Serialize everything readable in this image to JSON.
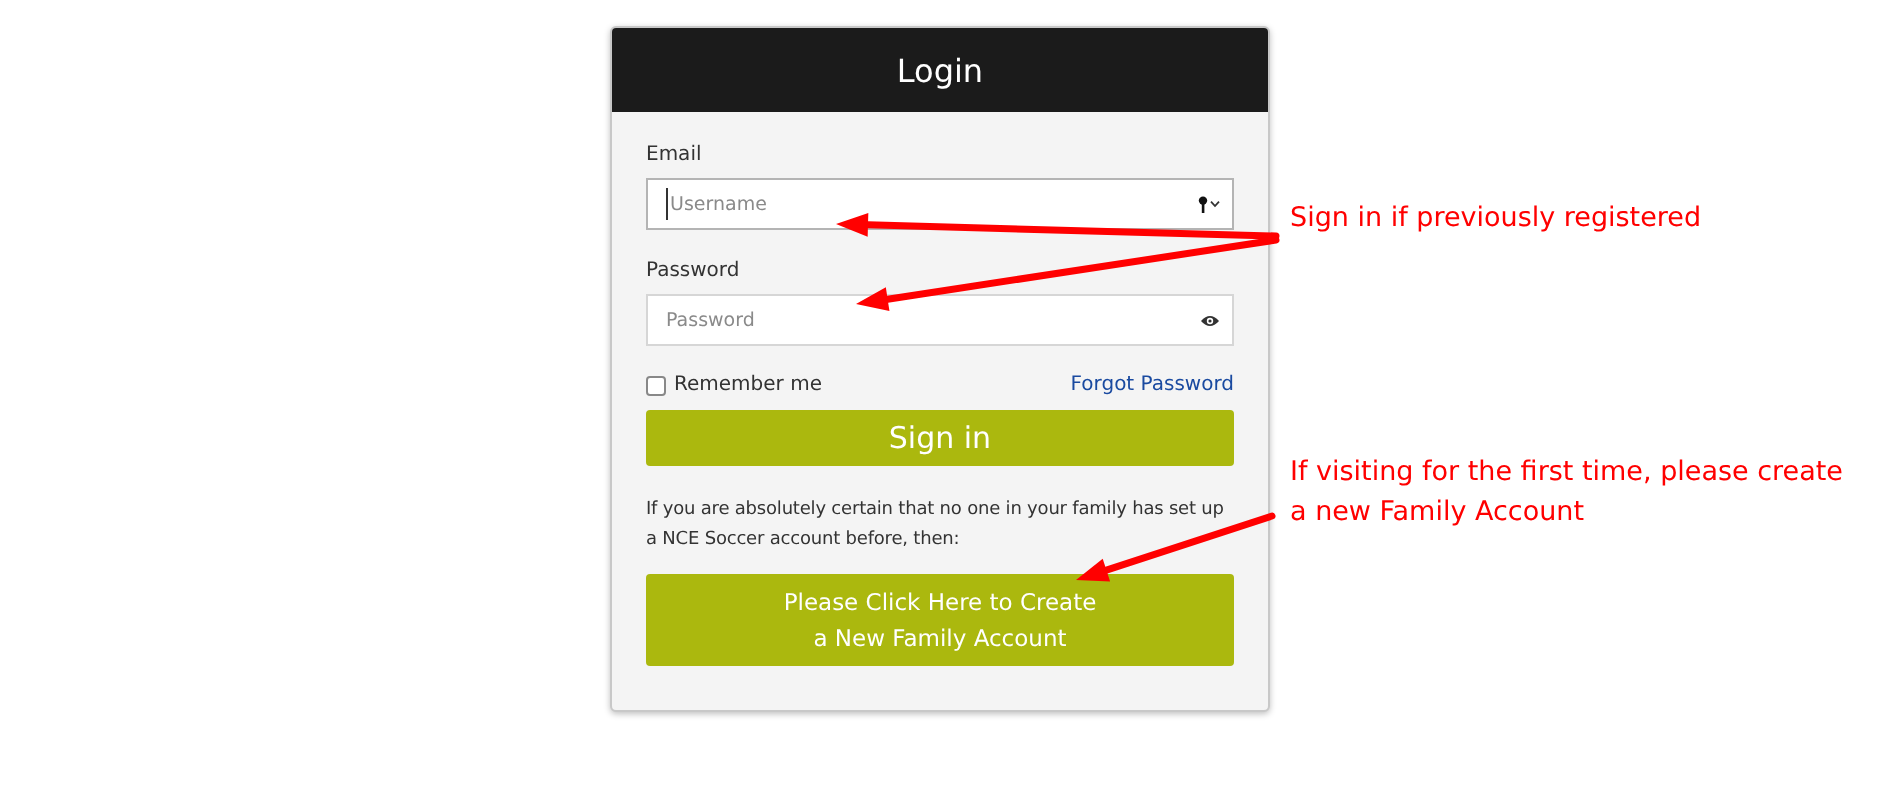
{
  "login_card": {
    "title": "Login",
    "fields": [
      {
        "label": "Email",
        "placeholder": "Username",
        "kind": "username",
        "focused": true
      },
      {
        "label": "Password",
        "placeholder": "Password",
        "kind": "password",
        "focused": false
      }
    ],
    "remember_me": {
      "label": "Remember me",
      "checked": false
    },
    "forgot_password": "Forgot Password",
    "sign_in_button": "Sign in",
    "note": "If you are absolutely certain that no one in your family has set up a NCE Soccer account before, then:",
    "create_account_button": [
      "Please Click Here to Create",
      "a New Family Account"
    ]
  },
  "annotations": [
    {
      "lines": [
        "Sign in if previously registered"
      ]
    },
    {
      "lines": [
        "If visiting for the first time, please create",
        "a new Family Account"
      ]
    }
  ]
}
